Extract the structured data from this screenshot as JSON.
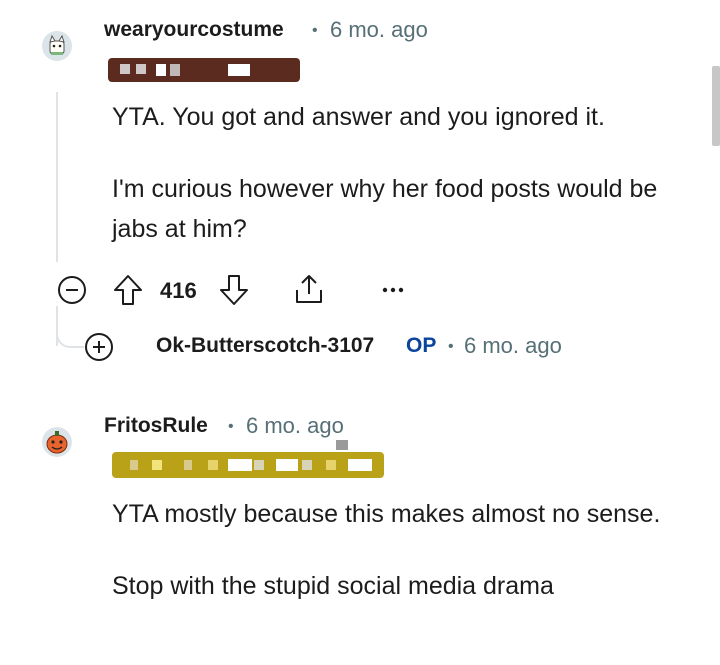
{
  "comments": [
    {
      "username": "wearyourcostume",
      "separator": "•",
      "time": "6 mo. ago",
      "avatar_icon": "cat-avatar-icon",
      "paragraphs": [
        "YTA. You got and answer and you ignored it.",
        "I'm curious however why her food posts would be jabs at him?"
      ],
      "score": "416",
      "colors": {
        "flair": "#5b2b1f"
      }
    },
    {
      "username": "FritosRule",
      "separator": "•",
      "time": "6 mo. ago",
      "avatar_icon": "pumpkin-avatar-icon",
      "paragraphs": [
        "YTA mostly because this makes almost no sense.",
        "Stop with the stupid social media drama"
      ],
      "colors": {
        "flair": "#b9a118"
      }
    }
  ],
  "collapsed_reply": {
    "username": "Ok-Butterscotch-3107",
    "op_badge": "OP",
    "separator": "•",
    "time": "6 mo. ago",
    "expand_icon": "plus-circle-icon"
  },
  "actions": {
    "collapse_icon": "minus-circle-icon",
    "upvote_icon": "upvote-arrow-icon",
    "downvote_icon": "downvote-arrow-icon",
    "share_icon": "share-icon",
    "more_icon": "more-dots-icon"
  },
  "colors": {
    "meta": "#576f76",
    "op": "#0a449b",
    "thread": "#dfe3e5"
  }
}
